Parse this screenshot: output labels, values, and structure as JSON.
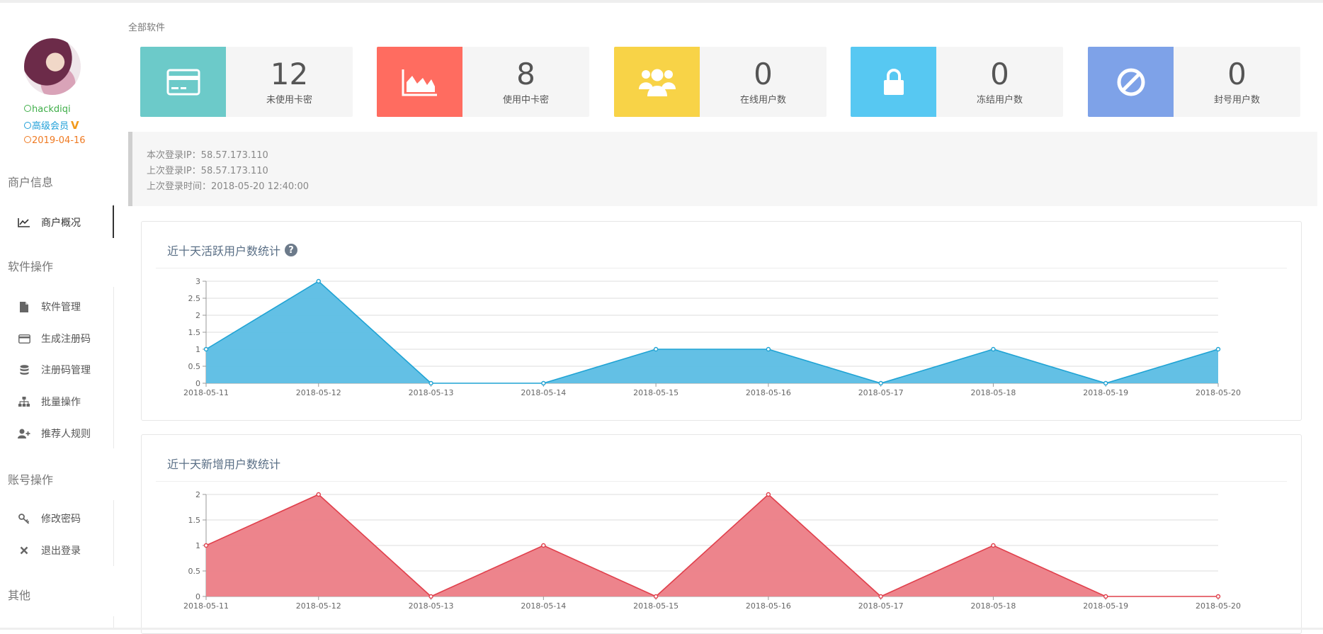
{
  "user": {
    "name": "hackdiqi",
    "level": "高级会员",
    "vip_badge": "V",
    "expire": "2019-04-16"
  },
  "sidebar": {
    "sections": [
      {
        "title": "商户信息",
        "items": [
          {
            "label": "商户概况",
            "icon": "line-chart-icon",
            "active": true
          }
        ]
      },
      {
        "title": "软件操作",
        "items": [
          {
            "label": "软件管理",
            "icon": "file-icon"
          },
          {
            "label": "生成注册码",
            "icon": "credit-card-icon"
          },
          {
            "label": "注册码管理",
            "icon": "database-icon"
          },
          {
            "label": "批量操作",
            "icon": "sitemap-icon"
          },
          {
            "label": "推荐人规则",
            "icon": "user-plus-icon"
          }
        ]
      },
      {
        "title": "账号操作",
        "items": [
          {
            "label": "修改密码",
            "icon": "key-icon"
          },
          {
            "label": "退出登录",
            "icon": "close-icon"
          }
        ]
      },
      {
        "title": "其他",
        "items": []
      }
    ]
  },
  "breadcrumb": "全部软件",
  "stats": [
    {
      "value": "12",
      "label": "未使用卡密",
      "color": "#6ccac9",
      "icon": "credit-card-icon"
    },
    {
      "value": "8",
      "label": "使用中卡密",
      "color": "#ff6c60",
      "icon": "area-chart-icon"
    },
    {
      "value": "0",
      "label": "在线用户数",
      "color": "#f8d347",
      "icon": "users-icon"
    },
    {
      "value": "0",
      "label": "冻结用户数",
      "color": "#57c8f2",
      "icon": "lock-icon"
    },
    {
      "value": "0",
      "label": "封号用户数",
      "color": "#7ea2e8",
      "icon": "ban-icon"
    }
  ],
  "login_info": {
    "current_ip": "本次登录IP：58.57.173.110",
    "last_ip": "上次登录IP：58.57.173.110",
    "last_time": "上次登录时间：2018-05-20 12:40:00"
  },
  "panels": {
    "active_title": "近十天活跃用户数统计",
    "active_help": "?",
    "new_title": "近十天新增用户数统计"
  },
  "chart_data": [
    {
      "type": "area",
      "title": "近十天活跃用户数统计",
      "x": [
        "2018-05-11",
        "2018-05-12",
        "2018-05-13",
        "2018-05-14",
        "2018-05-15",
        "2018-05-16",
        "2018-05-17",
        "2018-05-18",
        "2018-05-19",
        "2018-05-20"
      ],
      "values": [
        1,
        3,
        0,
        0,
        1,
        1,
        0,
        1,
        0,
        1
      ],
      "ylim": [
        0,
        3
      ],
      "yticks": [
        "0",
        "0.5",
        "1",
        "1.5",
        "2",
        "2.5",
        "3"
      ],
      "color": "#1fa3d4",
      "fill": "#5bbde4",
      "grid": true
    },
    {
      "type": "area",
      "title": "近十天新增用户数统计",
      "x": [
        "2018-05-11",
        "2018-05-12",
        "2018-05-13",
        "2018-05-14",
        "2018-05-15",
        "2018-05-16",
        "2018-05-17",
        "2018-05-18",
        "2018-05-19",
        "2018-05-20"
      ],
      "values": [
        1,
        2,
        0,
        1,
        0,
        2,
        0,
        1,
        0,
        0
      ],
      "ylim": [
        0,
        2
      ],
      "yticks": [
        "0",
        "0.5",
        "1",
        "1.5",
        "2"
      ],
      "color": "#e0404c",
      "fill": "#ec7d86",
      "grid": true
    }
  ]
}
